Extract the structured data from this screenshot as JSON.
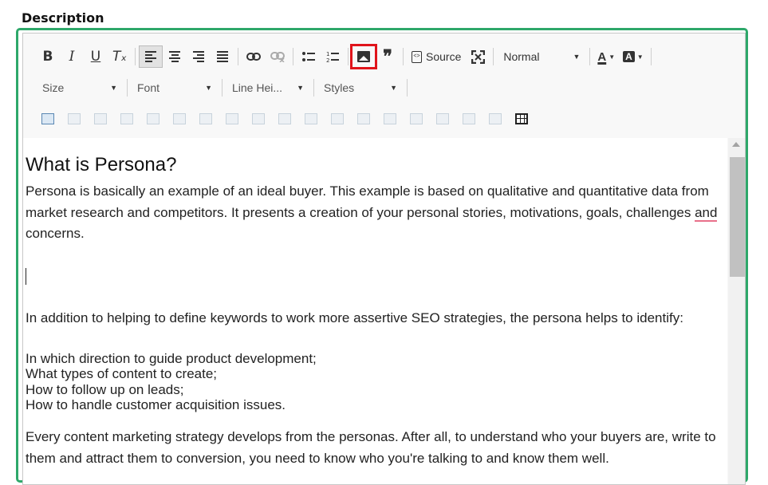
{
  "field_label": "Description",
  "toolbar": {
    "bold": "B",
    "italic": "I",
    "underline": "U",
    "remove_format": "Tₓ",
    "link_icon": "link-icon",
    "unlink_icon": "unlink-icon",
    "blockquote": "❞",
    "source_label": "Source",
    "format_value": "Normal",
    "font_color": "A",
    "bg_color": "A"
  },
  "toolbar_row2": {
    "size_label": "Size",
    "font_label": "Font",
    "line_height_label": "Line Hei...",
    "styles_label": "Styles"
  },
  "colors": {
    "border_accent": "#2ea86a",
    "highlight": "#e0141b"
  },
  "content": {
    "heading": "What is Persona?",
    "para1_before": "Persona is basically an example of an ideal buyer. This example is based on qualitative and quantitative data from market research and competitors. It presents a creation of your personal stories, motivations, goals, challenges ",
    "para1_misspelled": "and",
    "para1_after": " concerns.",
    "para2": "In addition to helping to define keywords to work more assertive SEO strategies, the persona helps to identify:",
    "list": [
      "In which direction to guide product development;",
      "What types of content to create;",
      "How to follow up on leads;",
      "How to handle customer acquisition issues."
    ],
    "para3": "Every content marketing strategy develops from the personas. After all, to understand who your buyers are, write to them and attract them to conversion, you need to know who you're talking to and know them well."
  }
}
